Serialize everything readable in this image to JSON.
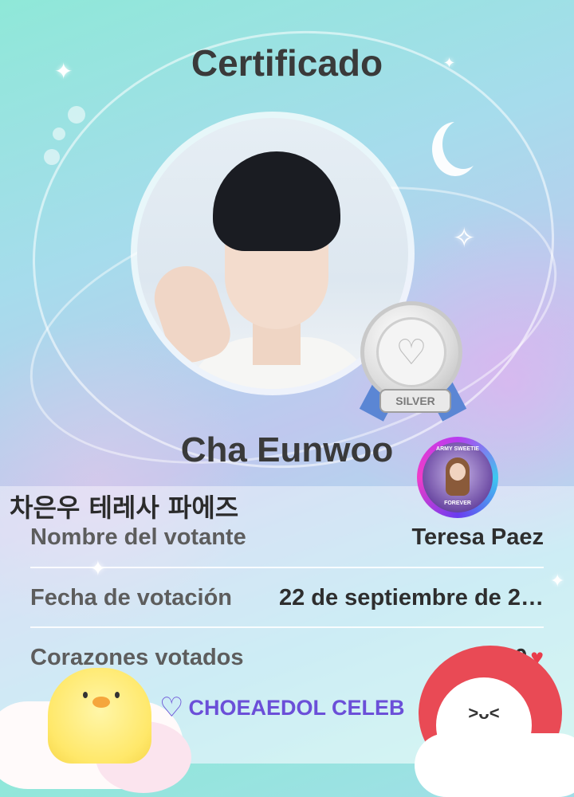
{
  "certificate": {
    "title": "Certificado",
    "celebrity_name": "Cha Eunwoo",
    "medal": {
      "tier": "SILVER",
      "emblem": "♡"
    },
    "avatar_badge": {
      "top_text": "ARMY SWEETIE",
      "bottom_text": "FOREVER",
      "icon": "avatar-badge-icon"
    },
    "korean_caption": "차은우 테레사 파에즈",
    "rows": [
      {
        "label": "Nombre del votante",
        "value": "Teresa Paez"
      },
      {
        "label": "Fecha de votación",
        "value": "22 de septiembre de 2…"
      },
      {
        "label": "Corazones votados",
        "value": "1,800"
      }
    ],
    "heart_icon": "heart-icon",
    "brand": {
      "logo": "♡",
      "name": "CHOEAEDOL CELEB"
    },
    "mascot_face": ">ᴗ<"
  },
  "colors": {
    "title_text": "#3a3a3a",
    "heart": "#e93c4b",
    "brand": "#6b4fd8",
    "medal_ribbon": "#5b86d4"
  }
}
